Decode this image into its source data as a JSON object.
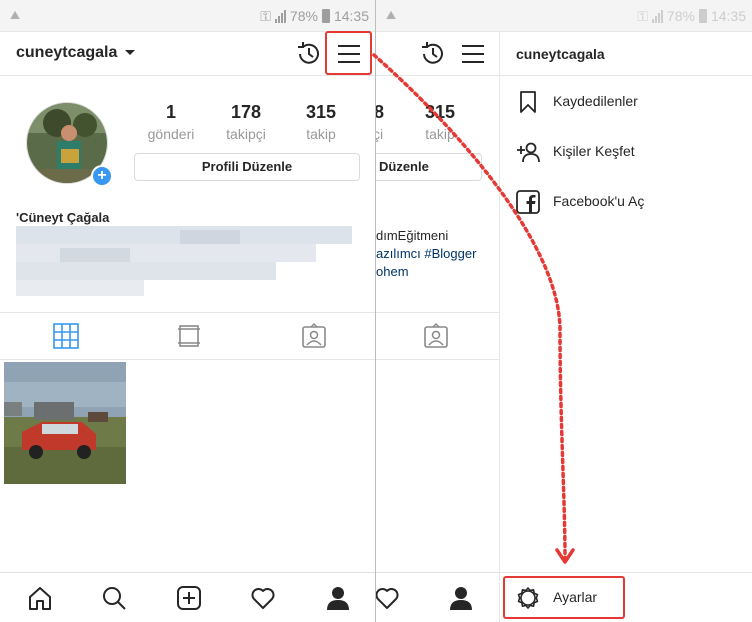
{
  "status": {
    "battery": "78%",
    "time": "14:35"
  },
  "profile": {
    "username": "cuneytcagala",
    "full_name": "'Cüneyt Çağala",
    "stats": [
      {
        "value": "1",
        "label": "gönderi"
      },
      {
        "value": "178",
        "label": "takipçi"
      },
      {
        "value": "315",
        "label": "takip"
      }
    ],
    "edit_button": "Profili Düzenle"
  },
  "right_peek": {
    "stats": [
      {
        "value": "8",
        "label": "çi"
      },
      {
        "value": "315",
        "label": "takip"
      }
    ],
    "edit_button": "Düzenle",
    "bio": [
      "dımEğitmeni",
      "azılımcı #Blogger",
      "ohem"
    ]
  },
  "drawer": {
    "username": "cuneytcagala",
    "items": [
      {
        "label": "Kaydedilenler",
        "icon": "bookmark-icon"
      },
      {
        "label": "Kişiler Keşfet",
        "icon": "add-person-icon"
      },
      {
        "label": "Facebook'u Aç",
        "icon": "facebook-icon"
      }
    ],
    "settings_label": "Ayarlar"
  },
  "colors": {
    "accent_blue": "#3897f0",
    "highlight_red": "#e53935",
    "text": "#262626",
    "muted": "#999999"
  }
}
